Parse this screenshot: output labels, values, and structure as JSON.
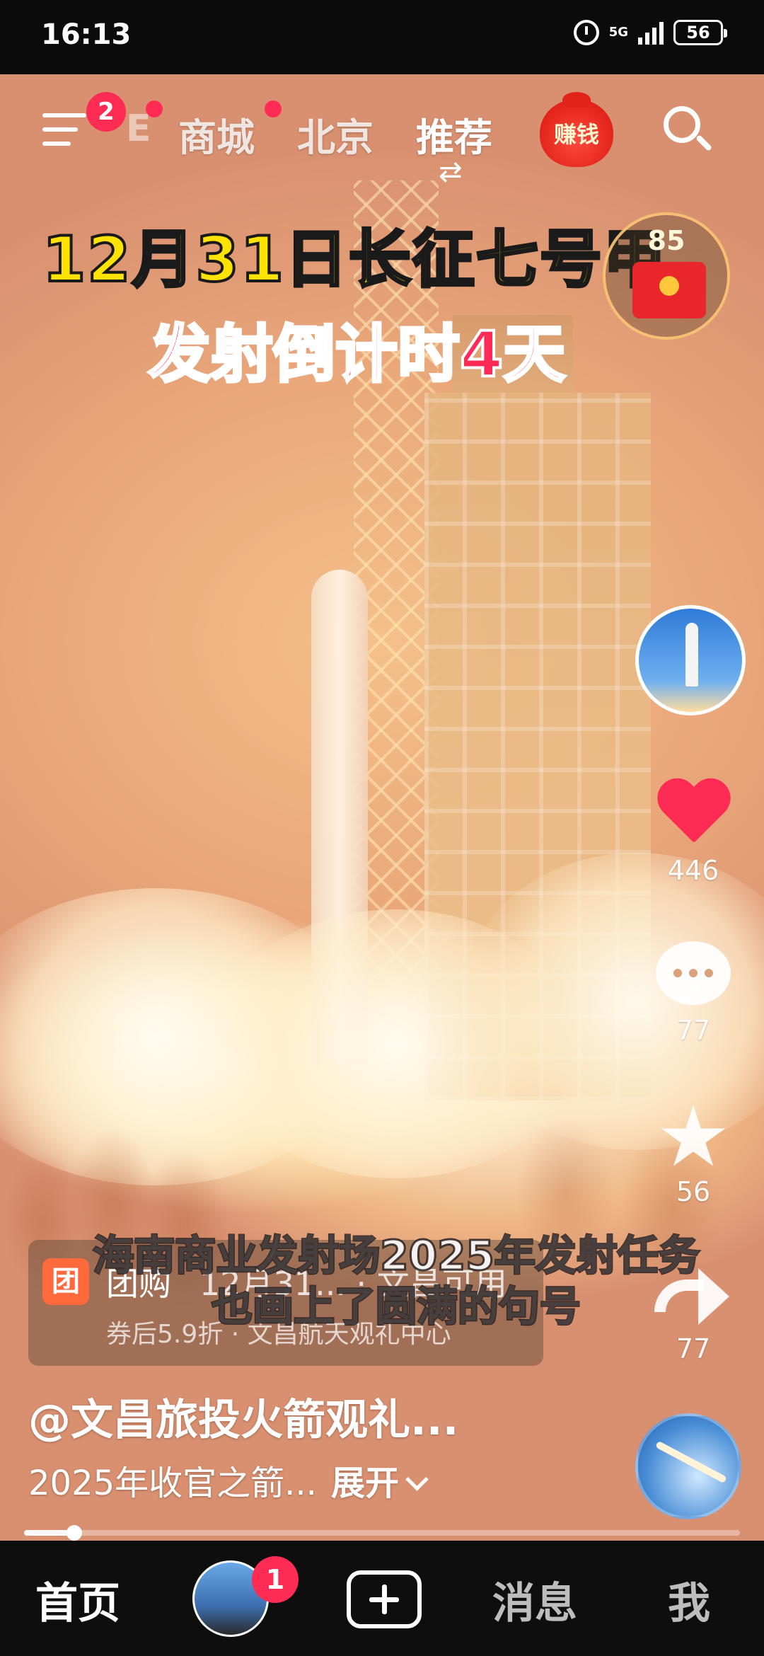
{
  "status_bar": {
    "time": "16:13",
    "network": "5G",
    "battery": "56",
    "icons": [
      "alarm-icon",
      "signal-icon",
      "battery-icon"
    ]
  },
  "top_nav": {
    "menu_badge": "2",
    "faded_tab": "E",
    "tabs": [
      {
        "label": "商城",
        "active": false
      },
      {
        "label": "北京",
        "active": false
      },
      {
        "label": "推荐",
        "active": true
      }
    ],
    "switch_glyph": "⇄",
    "earn_label": "赚钱"
  },
  "video": {
    "title_line1": "12月31日长征七号甲",
    "title_line2": "发射倒计时4天",
    "red_packet_count": "85",
    "subtitle_line1": "海南商业发射场2025年发射任务",
    "subtitle_line2": "也画上了圆满的句号"
  },
  "actions": {
    "like_count": "446",
    "comment_count": "77",
    "favorite_count": "56",
    "share_count": "77",
    "like_color": "#fe2c55"
  },
  "group_buy": {
    "logo": "团",
    "tag": "团购",
    "title": "12月31... · 文昌可用",
    "subtitle": "券后5.9折 · 文昌航天观礼中心"
  },
  "caption": {
    "author": "@文昌旅投火箭观礼...",
    "text": "2025年收官之箭...",
    "expand": "展开"
  },
  "progress": {
    "fraction": 0.07
  },
  "bottom_nav": {
    "home": "首页",
    "friend_badge": "1",
    "messages": "消息",
    "me": "我"
  }
}
